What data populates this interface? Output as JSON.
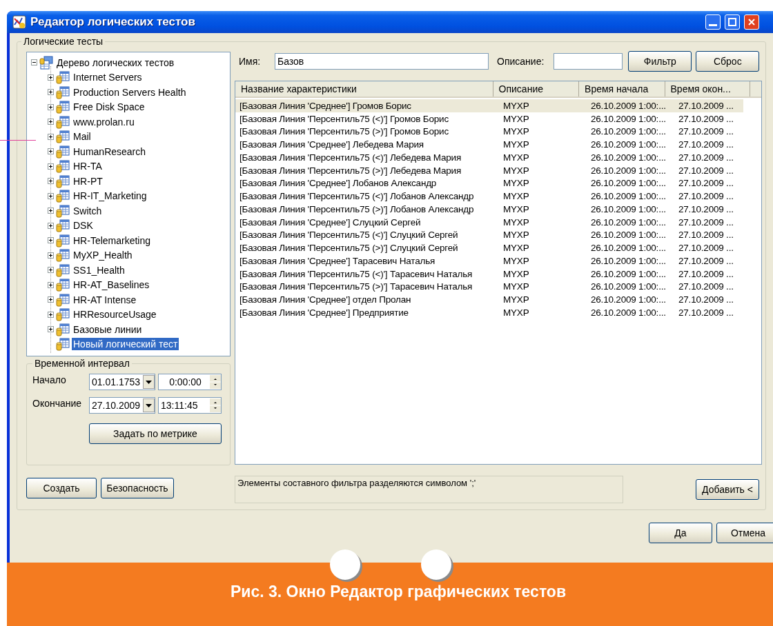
{
  "window": {
    "title": "Редактор логических тестов"
  },
  "tests_group": {
    "label": "Логические тесты"
  },
  "tree": {
    "label": "Дерево логических тестов",
    "expanded": true,
    "children": [
      {
        "label": "Internet Servers",
        "kind": "group",
        "expanded": false,
        "selected": false
      },
      {
        "label": "Production Servers Health",
        "kind": "group",
        "expanded": false,
        "selected": false
      },
      {
        "label": "Free Disk Space",
        "kind": "group",
        "expanded": false,
        "selected": false
      },
      {
        "label": "www.prolan.ru",
        "kind": "group",
        "expanded": false,
        "selected": false
      },
      {
        "label": "Mail",
        "kind": "group",
        "expanded": false,
        "selected": false
      },
      {
        "label": "HumanResearch",
        "kind": "group",
        "expanded": false,
        "selected": false
      },
      {
        "label": "HR-TA",
        "kind": "group",
        "expanded": false,
        "selected": false
      },
      {
        "label": "HR-PT",
        "kind": "group",
        "expanded": false,
        "selected": false
      },
      {
        "label": "HR-IT_Marketing",
        "kind": "group",
        "expanded": false,
        "selected": false
      },
      {
        "label": "Switch",
        "kind": "group",
        "expanded": false,
        "selected": false
      },
      {
        "label": "DSK",
        "kind": "group",
        "expanded": false,
        "selected": false
      },
      {
        "label": "HR-Telemarketing",
        "kind": "group",
        "expanded": false,
        "selected": false
      },
      {
        "label": "MyXP_Health",
        "kind": "group",
        "expanded": false,
        "selected": false
      },
      {
        "label": "SS1_Health",
        "kind": "group",
        "expanded": false,
        "selected": false
      },
      {
        "label": "HR-AT_Baselines",
        "kind": "group",
        "expanded": false,
        "selected": false
      },
      {
        "label": "HR-AT Intense",
        "kind": "group",
        "expanded": false,
        "selected": false
      },
      {
        "label": "HRResourceUsage",
        "kind": "group",
        "expanded": false,
        "selected": false
      },
      {
        "label": "Базовые линии",
        "kind": "group",
        "expanded": false,
        "selected": false
      },
      {
        "label": "Новый логический тест",
        "kind": "leaf",
        "selected": true
      }
    ]
  },
  "interval": {
    "title": "Временной интервал",
    "start_label": "Начало",
    "start_date": "01.01.1753",
    "start_time": "0:00:00",
    "end_label": "Окончание",
    "end_date": "27.10.2009",
    "end_time": "13:11:45",
    "metric_button": "Задать по метрике"
  },
  "left_buttons": [
    "Создать",
    "Безопасность"
  ],
  "filter": {
    "name_label": "Имя:",
    "name_value": "Базов",
    "description_label": "Описание:",
    "buttons": [
      "Фильтр",
      "Сброс"
    ]
  },
  "table": {
    "columns": [
      "Название характеристики",
      "Описание",
      "Время начала",
      "Время окон..."
    ],
    "rows": [
      {
        "selected": true,
        "cells": [
          "[Базовая Линия 'Среднее'] Громов Борис",
          "MYXP",
          "26.10.2009 1:00:...",
          "27.10.2009 ..."
        ]
      },
      {
        "selected": false,
        "cells": [
          "[Базовая Линия 'Персентиль75 (<)'] Громов Борис",
          "MYXP",
          "26.10.2009 1:00:...",
          "27.10.2009 ..."
        ]
      },
      {
        "selected": false,
        "cells": [
          "[Базовая Линия 'Персентиль75 (>)'] Громов Борис",
          "MYXP",
          "26.10.2009 1:00:...",
          "27.10.2009 ..."
        ]
      },
      {
        "selected": false,
        "cells": [
          "[Базовая Линия 'Среднее'] Лебедева Мария",
          "MYXP",
          "26.10.2009 1:00:...",
          "27.10.2009 ..."
        ]
      },
      {
        "selected": false,
        "cells": [
          "[Базовая Линия 'Персентиль75 (<)'] Лебедева Мария",
          "MYXP",
          "26.10.2009 1:00:...",
          "27.10.2009 ..."
        ]
      },
      {
        "selected": false,
        "cells": [
          "[Базовая Линия 'Персентиль75 (>)'] Лебедева Мария",
          "MYXP",
          "26.10.2009 1:00:...",
          "27.10.2009 ..."
        ]
      },
      {
        "selected": false,
        "cells": [
          "[Базовая Линия 'Среднее'] Лобанов Александр",
          "MYXP",
          "26.10.2009 1:00:...",
          "27.10.2009 ..."
        ]
      },
      {
        "selected": false,
        "cells": [
          "[Базовая Линия 'Персентиль75 (<)'] Лобанов Александр",
          "MYXP",
          "26.10.2009 1:00:...",
          "27.10.2009 ..."
        ]
      },
      {
        "selected": false,
        "cells": [
          "[Базовая Линия 'Персентиль75 (>)'] Лобанов Александр",
          "MYXP",
          "26.10.2009 1:00:...",
          "27.10.2009 ..."
        ]
      },
      {
        "selected": false,
        "cells": [
          "[Базовая Линия 'Среднее'] Слуцкий Сергей",
          "MYXP",
          "26.10.2009 1:00:...",
          "27.10.2009 ..."
        ]
      },
      {
        "selected": false,
        "cells": [
          "[Базовая Линия 'Персентиль75 (<)'] Слуцкий Сергей",
          "MYXP",
          "26.10.2009 1:00:...",
          "27.10.2009 ..."
        ]
      },
      {
        "selected": false,
        "cells": [
          "[Базовая Линия 'Персентиль75 (>)'] Слуцкий Сергей",
          "MYXP",
          "26.10.2009 1:00:...",
          "27.10.2009 ..."
        ]
      },
      {
        "selected": false,
        "cells": [
          "[Базовая Линия 'Среднее'] Тарасевич Наталья",
          "MYXP",
          "26.10.2009 1:00:...",
          "27.10.2009 ..."
        ]
      },
      {
        "selected": false,
        "cells": [
          "[Базовая Линия 'Персентиль75 (<)'] Тарасевич Наталья",
          "MYXP",
          "26.10.2009 1:00:...",
          "27.10.2009 ..."
        ]
      },
      {
        "selected": false,
        "cells": [
          "[Базовая Линия 'Персентиль75 (>)'] Тарасевич Наталья",
          "MYXP",
          "26.10.2009 1:00:...",
          "27.10.2009 ..."
        ]
      },
      {
        "selected": false,
        "cells": [
          "[Базовая Линия 'Среднее'] отдел Пролан",
          "MYXP",
          "26.10.2009 1:00:...",
          "27.10.2009 ..."
        ]
      },
      {
        "selected": false,
        "cells": [
          "[Базовая Линия 'Среднее'] Предприятие",
          "MYXP",
          "26.10.2009 1:00:...",
          "27.10.2009 ..."
        ]
      }
    ]
  },
  "hint": "Элементы составного фильтра разделяются символом ';'",
  "add_button": "Добавить <",
  "dialog_buttons": [
    "Да",
    "Отмена"
  ],
  "caption": "Рис. 3. Окно Редактор графических тестов"
}
